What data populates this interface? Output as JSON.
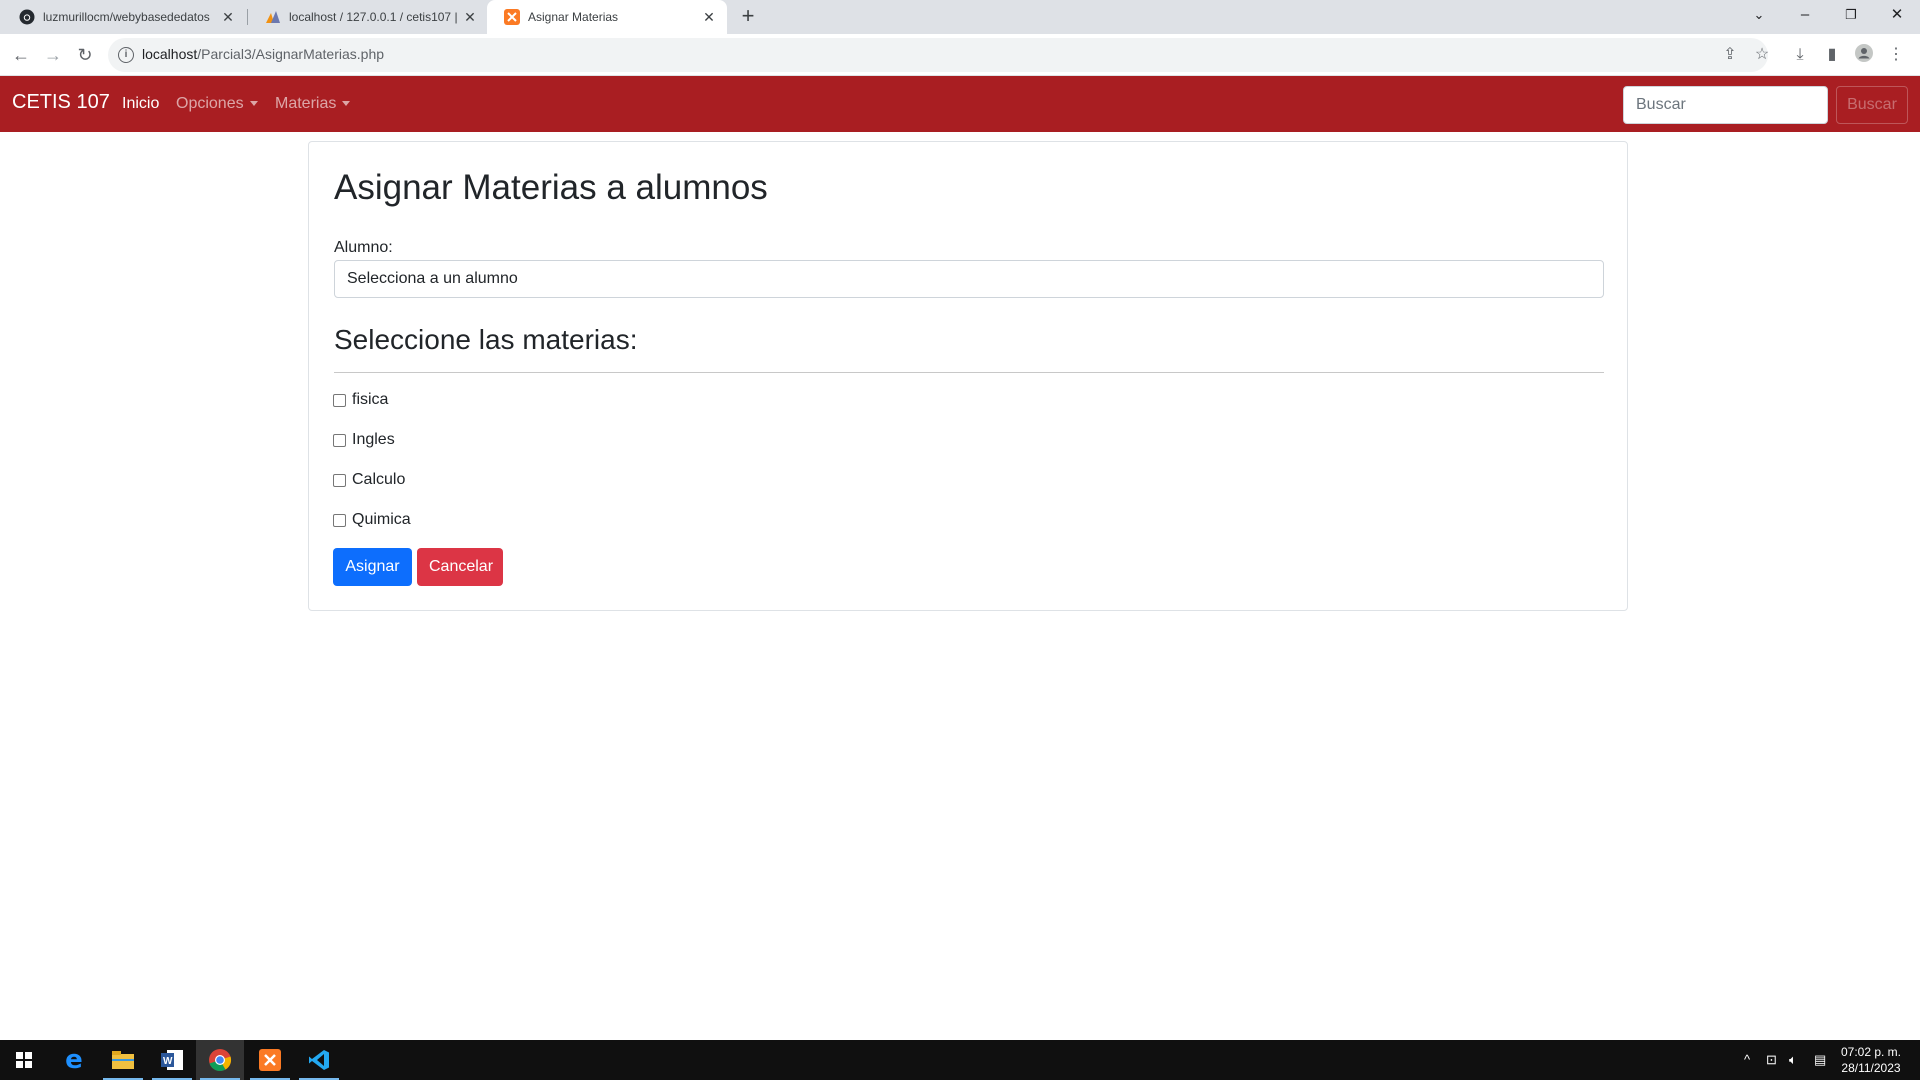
{
  "browser": {
    "tabs": [
      {
        "title": "luzmurillocm/webybasededatos",
        "icon": "github-icon"
      },
      {
        "title": "localhost / 127.0.0.1 / cetis107 |",
        "icon": "phpmyadmin-icon"
      },
      {
        "title": "Asignar Materias",
        "icon": "xampp-icon",
        "active": true
      }
    ],
    "new_tab": "+",
    "address": {
      "host": "localhost",
      "path": "/Parcial3/AsignarMaterias.php"
    }
  },
  "navbar": {
    "brand": "CETIS 107",
    "links": [
      {
        "label": "Inicio",
        "active": true
      },
      {
        "label": "Opciones",
        "dropdown": true
      },
      {
        "label": "Materias",
        "dropdown": true
      }
    ],
    "search_placeholder": "Buscar",
    "search_button": "Buscar",
    "color": "#a91e22"
  },
  "form": {
    "title": "Asignar Materias a alumnos",
    "alumno_label": "Alumno:",
    "alumno_select_value": "Selecciona a un alumno",
    "materias_heading": "Seleccione las materias:",
    "materias": [
      {
        "label": "fisica",
        "checked": false
      },
      {
        "label": "Ingles",
        "checked": false
      },
      {
        "label": "Calculo",
        "checked": false
      },
      {
        "label": "Quimica",
        "checked": false
      }
    ],
    "submit_label": "Asignar",
    "cancel_label": "Cancelar"
  },
  "taskbar": {
    "apps": [
      "windows-start-icon",
      "edge-icon",
      "file-explorer-icon",
      "word-icon",
      "chrome-icon",
      "xampp-icon",
      "vscode-icon"
    ],
    "time": "07:02 p. m.",
    "date": "28/11/2023"
  }
}
